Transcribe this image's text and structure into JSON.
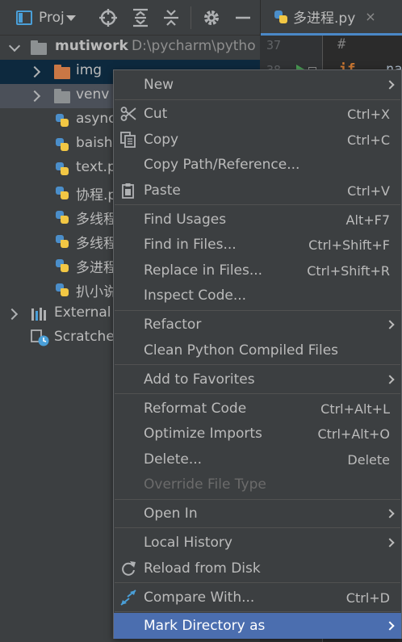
{
  "header": {
    "project_label": "Proj",
    "tab_title": "多进程.py",
    "tab_close": "×"
  },
  "editor": {
    "line_numbers": [
      "37",
      "38"
    ],
    "code_hash": "#",
    "code_if": "if",
    "code_tail": "na"
  },
  "tree": {
    "root_name": "mutiwork",
    "root_path": "D:\\pycharm\\pytho",
    "items": [
      {
        "label": "img",
        "kind": "folder-orange"
      },
      {
        "label": "venv",
        "kind": "folder-grey"
      },
      {
        "label": "async",
        "kind": "py"
      },
      {
        "label": "baish",
        "kind": "py"
      },
      {
        "label": "text.p",
        "kind": "py"
      },
      {
        "label": "协程.p",
        "kind": "py"
      },
      {
        "label": "多线程",
        "kind": "py"
      },
      {
        "label": "多线程",
        "kind": "py"
      },
      {
        "label": "多进程",
        "kind": "py"
      },
      {
        "label": "扒小说",
        "kind": "py"
      }
    ],
    "external_label": "External",
    "scratches_label": "Scratche"
  },
  "menu": {
    "new": "New",
    "cut": "Cut",
    "cut_sc": "Ctrl+X",
    "copy": "Copy",
    "copy_sc": "Ctrl+C",
    "copy_path": "Copy Path/Reference...",
    "paste": "Paste",
    "paste_sc": "Ctrl+V",
    "find_usages": "Find Usages",
    "find_usages_sc": "Alt+F7",
    "find_in_files": "Find in Files...",
    "find_in_files_sc": "Ctrl+Shift+F",
    "replace_in_files": "Replace in Files...",
    "replace_in_files_sc": "Ctrl+Shift+R",
    "inspect_code": "Inspect Code...",
    "refactor": "Refactor",
    "clean_python": "Clean Python Compiled Files",
    "add_favorites": "Add to Favorites",
    "reformat": "Reformat Code",
    "reformat_sc": "Ctrl+Alt+L",
    "optimize": "Optimize Imports",
    "optimize_sc": "Ctrl+Alt+O",
    "delete": "Delete...",
    "delete_sc": "Delete",
    "override": "Override File Type",
    "open_in": "Open In",
    "local_history": "Local History",
    "reload": "Reload from Disk",
    "compare": "Compare With...",
    "compare_sc": "Ctrl+D",
    "mark_directory": "Mark Directory as"
  }
}
